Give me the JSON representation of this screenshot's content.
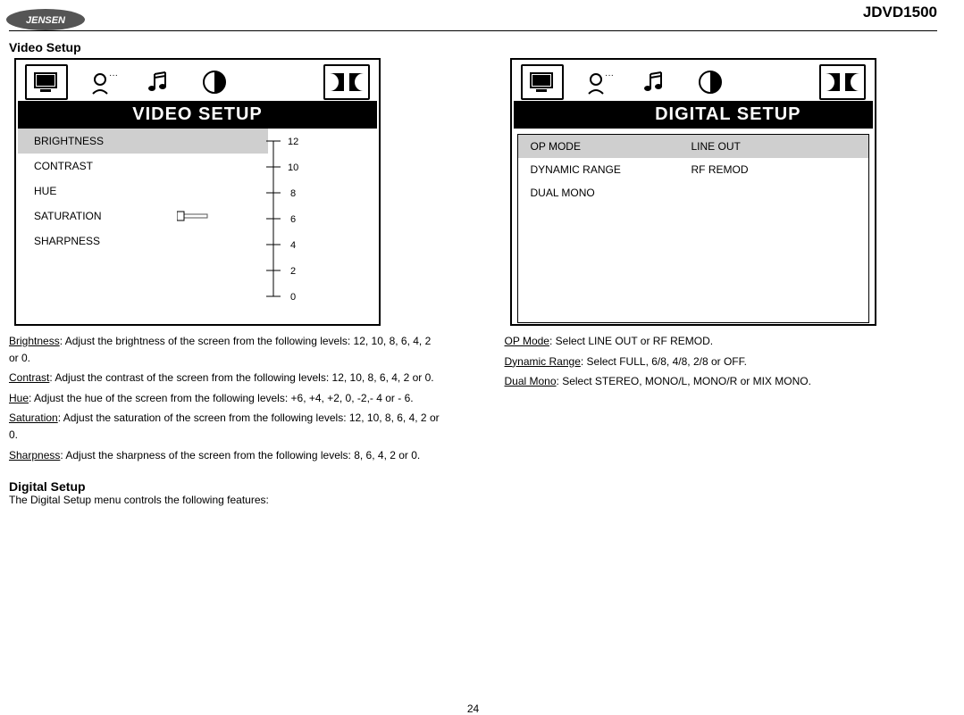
{
  "header": {
    "brand": "JENSEN",
    "model": "JDVD1500"
  },
  "page_number": "24",
  "left": {
    "section_title": "Video Setup",
    "panel_title": "VIDEO SETUP",
    "menu": [
      {
        "label": "BRIGHTNESS",
        "selected": true
      },
      {
        "label": "CONTRAST",
        "selected": false
      },
      {
        "label": "HUE",
        "selected": false
      },
      {
        "label": "SATURATION",
        "selected": false
      },
      {
        "label": "SHARPNESS",
        "selected": false
      }
    ],
    "scale": [
      "12",
      "10",
      "8",
      "6",
      "4",
      "2",
      "0"
    ],
    "desc": [
      {
        "u": "Brightness",
        "rest": ": Adjust the brightness of the screen from the following levels: 12, 10, 8, 6, 4, 2 or 0."
      },
      {
        "u": "Contrast",
        "rest": ": Adjust the contrast of the screen from the following levels: 12, 10, 8, 6, 4, 2 or 0."
      },
      {
        "u": "Hue",
        "rest": ": Adjust the hue of the screen from the following levels: +6, +4, +2, 0, -2,- 4 or - 6."
      },
      {
        "u": "Saturation",
        "rest": ": Adjust the saturation of the screen from the following levels: 12, 10, 8, 6, 4, 2 or 0."
      },
      {
        "u": "Sharpness",
        "rest": ": Adjust the sharpness of the screen from the following levels: 8, 6, 4, 2 or 0."
      }
    ],
    "digital_heading": "Digital Setup",
    "digital_sub": "The Digital Setup menu controls the following features:"
  },
  "right": {
    "panel_title": "DIGITAL SETUP",
    "rows": [
      {
        "left": "OP MODE",
        "right": "LINE OUT",
        "selected": true
      },
      {
        "left": "DYNAMIC RANGE",
        "right": "RF REMOD",
        "selected": false
      },
      {
        "left": "DUAL MONO",
        "right": "",
        "selected": false
      }
    ],
    "desc": [
      {
        "u": "OP Mode",
        "rest": ": Select LINE OUT or RF REMOD."
      },
      {
        "u": "Dynamic Range",
        "rest": ": Select FULL, 6/8, 4/8, 2/8 or OFF."
      },
      {
        "u": "Dual Mono",
        "rest": ": Select STEREO, MONO/L, MONO/R or MIX MONO."
      }
    ]
  },
  "icons": {
    "monitor": "monitor-icon",
    "person": "person-icon",
    "music": "music-icon",
    "contrast": "contrast-icon",
    "dolby": "dolby-icon"
  }
}
